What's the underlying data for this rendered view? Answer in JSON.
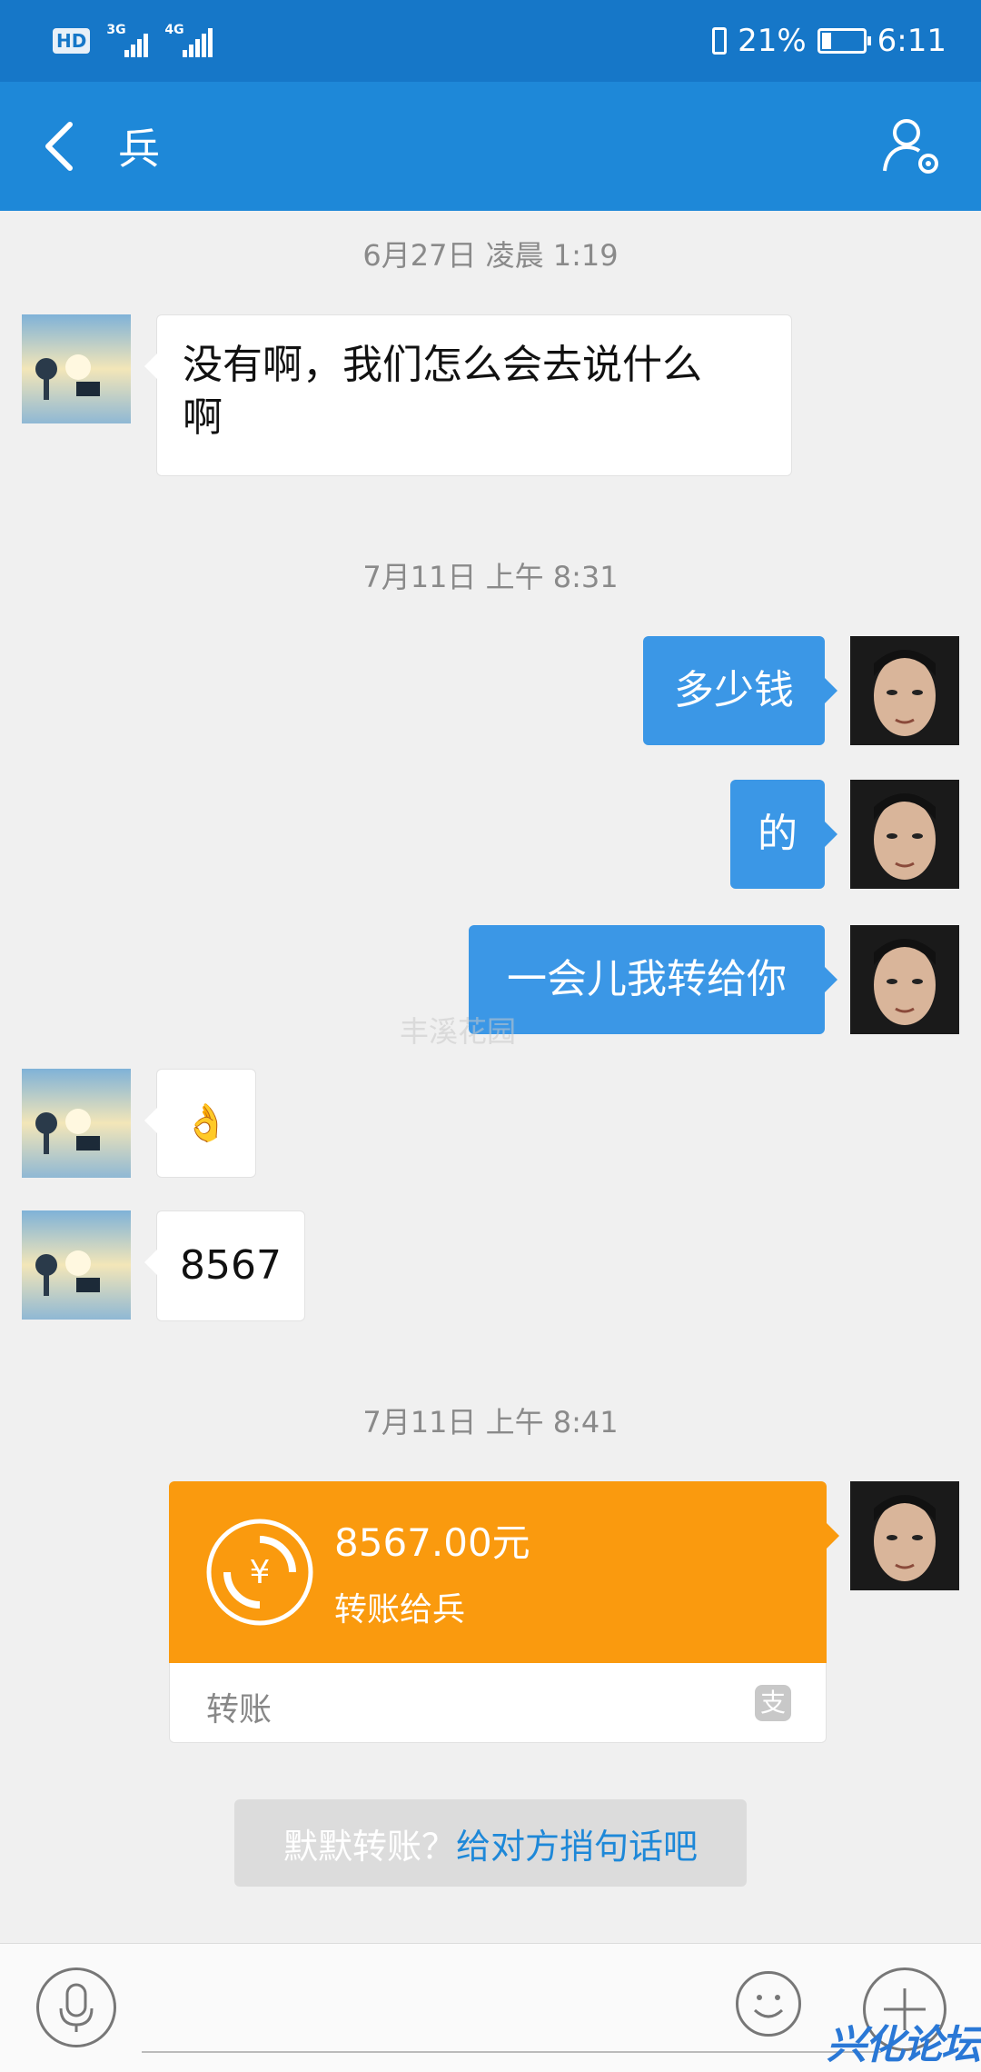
{
  "status_bar": {
    "hd": "HD",
    "network_1": "3G",
    "network_2": "4G",
    "battery_percent": "21%",
    "time": "6:11"
  },
  "header": {
    "back_icon": "chevron-left-icon",
    "title": "兵",
    "profile_icon": "person-settings-icon"
  },
  "messages": [
    {
      "type": "timestamp",
      "text": "6月27日 凌晨 1:19"
    },
    {
      "type": "text",
      "side": "left",
      "lines": [
        "没有啊，我们怎么会去说什么",
        "啊"
      ]
    },
    {
      "type": "timestamp",
      "text": "7月11日 上午 8:31"
    },
    {
      "type": "text",
      "side": "right",
      "text": "多少钱"
    },
    {
      "type": "text",
      "side": "right",
      "text": "的"
    },
    {
      "type": "text",
      "side": "right",
      "text": "一会儿我转给你"
    },
    {
      "type": "emoji",
      "side": "left",
      "text": "👌"
    },
    {
      "type": "text",
      "side": "left",
      "text": "8567"
    },
    {
      "type": "timestamp",
      "text": "7月11日 上午 8:41"
    },
    {
      "type": "transfer",
      "side": "right",
      "amount": "8567.00元",
      "desc": "转账给兵",
      "label": "转账",
      "icon": "alipay-icon"
    }
  ],
  "prompt": {
    "muted": "默默转账？",
    "link": "给对方捎句话吧"
  },
  "input_bar": {
    "mic_icon": "microphone-icon",
    "emoji_icon": "smiley-icon",
    "plus_icon": "plus-icon"
  },
  "watermarks": {
    "center": "丰溪花园",
    "corner": "兴化论坛"
  },
  "colors": {
    "header": "#1e88d8",
    "status_bar": "#1677c8",
    "bubble_right": "#3b97e6",
    "transfer": "#fa9a0e",
    "background": "#f0f0f0"
  }
}
